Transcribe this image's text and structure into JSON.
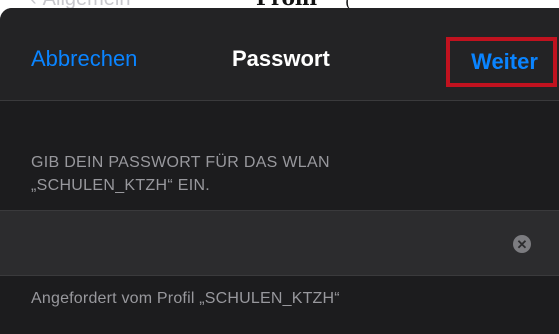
{
  "background_screen": {
    "back_label": "Allgemein",
    "title": "Profil",
    "stray_char": "("
  },
  "nav": {
    "cancel_label": "Abbrechen",
    "title": "Passwort",
    "next_label": "Weiter"
  },
  "prompt": {
    "line1": "GIB DEIN PASSWORT FÜR DAS WLAN",
    "line2": "„SCHULEN_KTZH“ EIN."
  },
  "password_field": {
    "value": "",
    "placeholder": ""
  },
  "footer": {
    "requested_by": "Angefordert vom Profil „SCHULEN_KTZH“"
  },
  "colors": {
    "accent": "#0a84ff",
    "highlight_box": "#c1121f",
    "sheet_bg": "#1c1c1e"
  },
  "icons": {
    "clear": "clear-icon",
    "back": "chevron-left-icon"
  }
}
